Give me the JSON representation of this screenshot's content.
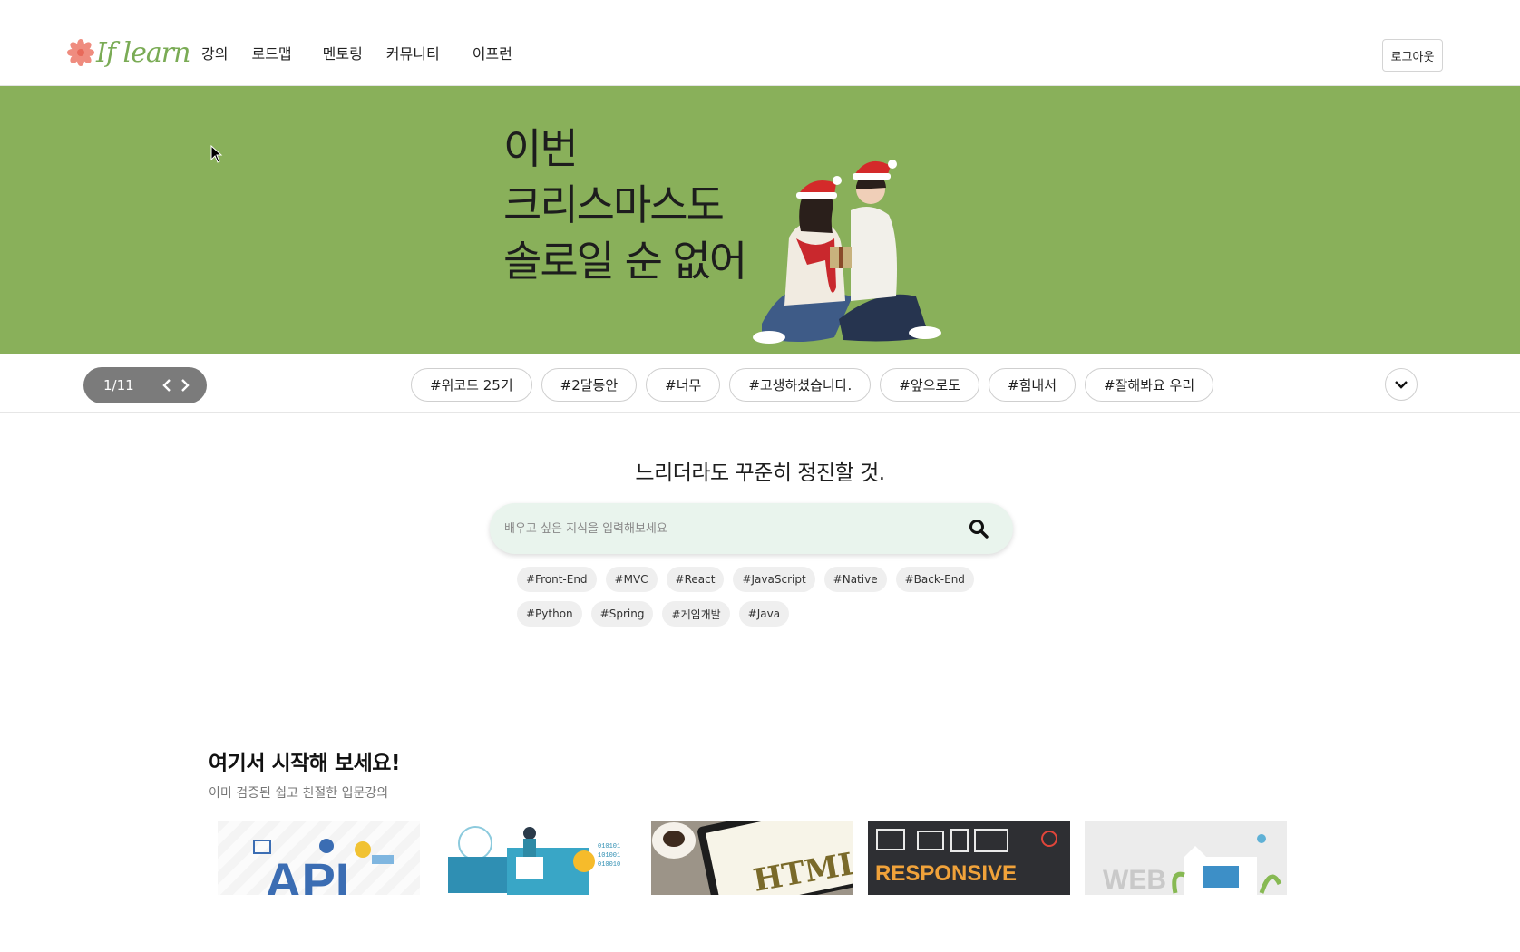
{
  "header": {
    "logo_text": "If learn",
    "nav": [
      "강의",
      "로드맵",
      "멘토링",
      "커뮤니티",
      "이프런"
    ],
    "logout_label": "로그아웃"
  },
  "banner": {
    "lines": [
      "이번",
      "크리스마스도",
      "솔로일 순 없어"
    ],
    "bg_color": "#89b05a"
  },
  "carousel": {
    "counter": "1/11",
    "tags": [
      "#위코드 25기",
      "#2달동안",
      "#너무",
      "#고생하셨습니다.",
      "#앞으로도",
      "#힘내서",
      "#잘해봐요 우리"
    ]
  },
  "search": {
    "tagline": "느리더라도 꾸준히 정진할 것.",
    "placeholder": "배우고 싶은 지식을 입력해보세요",
    "keywords": [
      "#Front-End",
      "#MVC",
      "#React",
      "#JavaScript",
      "#Native",
      "#Back-End",
      "#Python",
      "#Spring",
      "#게임개발",
      "#Java"
    ]
  },
  "section": {
    "title": "여기서 시작해 보세요!",
    "subtitle": "이미 검증된 쉽고 친절한 입문강의",
    "cards": [
      {
        "label": "API",
        "icon": "api-illustration"
      },
      {
        "label": "",
        "icon": "web-dev-illustration"
      },
      {
        "label": "HTML",
        "icon": "html-tablet-illustration"
      },
      {
        "label": "RESPONSIVE",
        "icon": "responsive-web-design-illustration"
      },
      {
        "label": "WEB",
        "icon": "web-illustration"
      }
    ]
  }
}
